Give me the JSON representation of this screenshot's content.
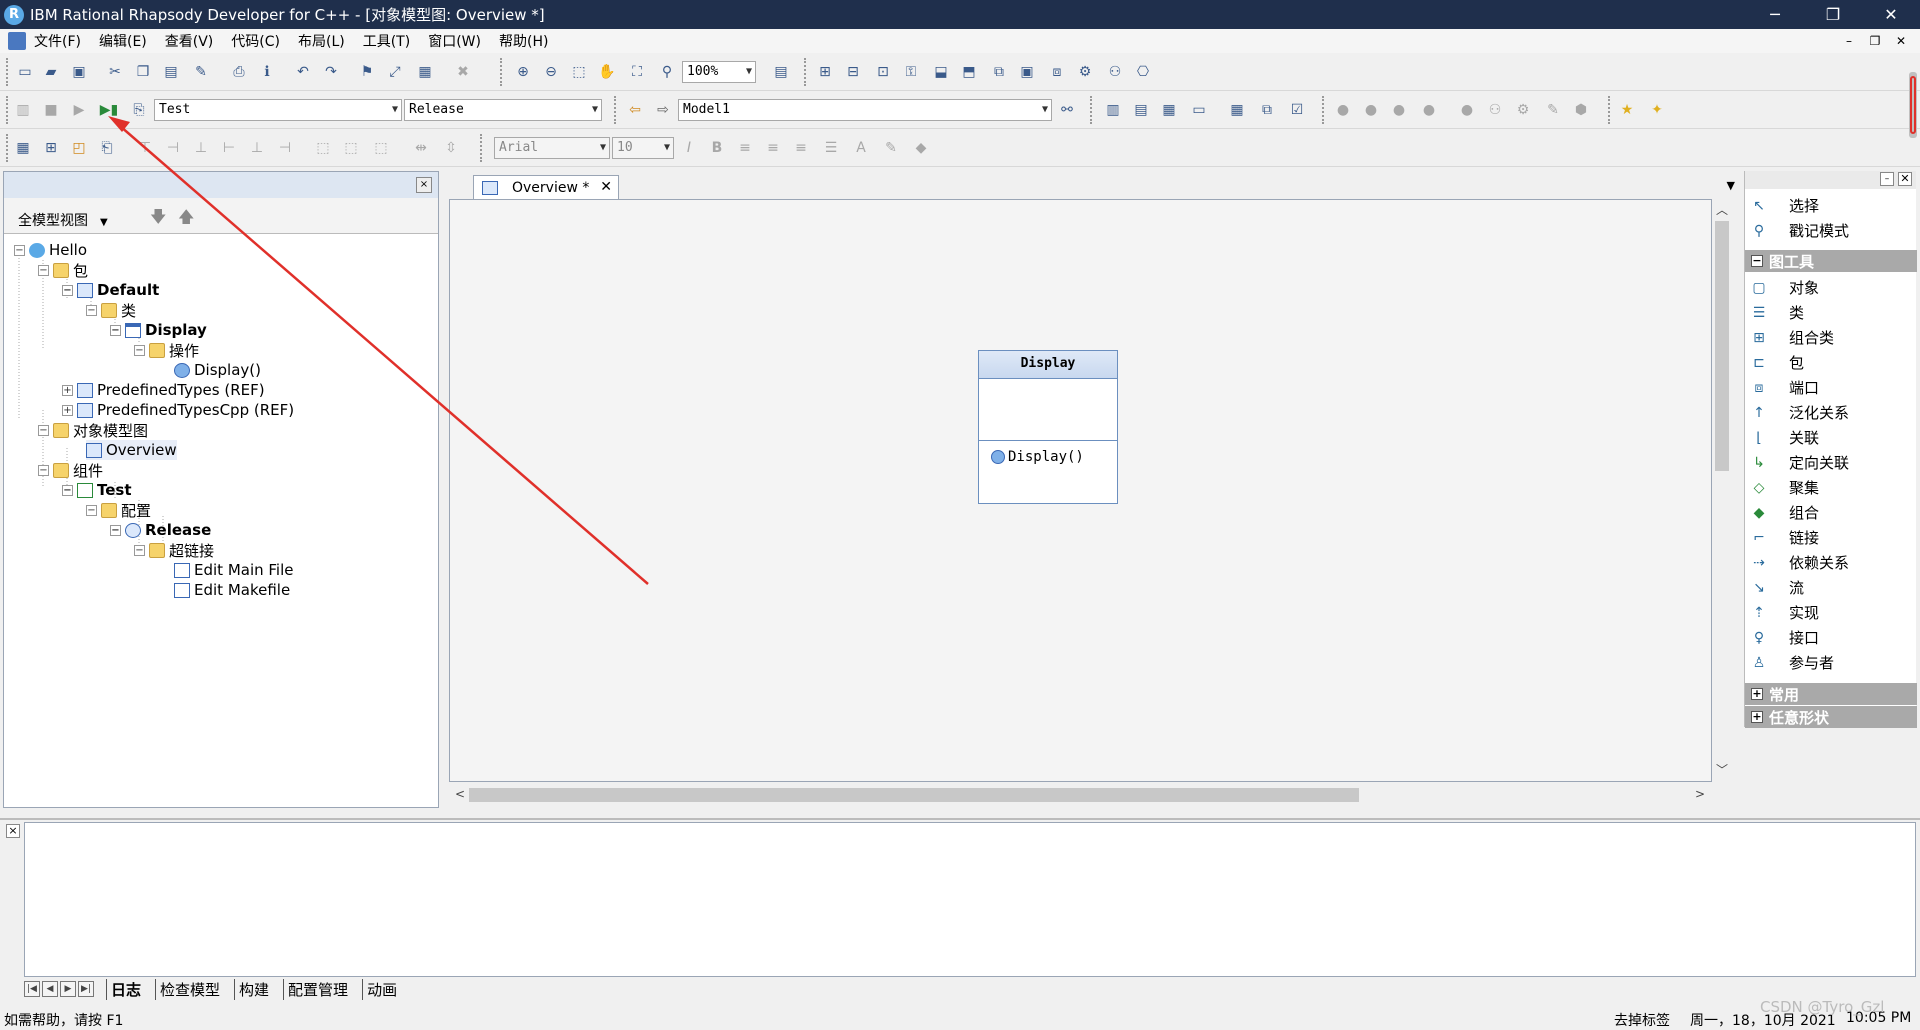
{
  "window": {
    "title": "IBM Rational Rhapsody Developer for C++ - [对象模型图: Overview *]",
    "app_icon": "R",
    "minimize": "─",
    "restore": "❐",
    "close": "✕"
  },
  "menu": {
    "items": [
      "文件(F)",
      "编辑(E)",
      "查看(V)",
      "代码(C)",
      "布局(L)",
      "工具(T)",
      "窗口(W)",
      "帮助(H)"
    ],
    "mdi_min": "–",
    "mdi_restore": "❐",
    "mdi_close": "✕"
  },
  "toolbar": {
    "zoom_value": "100%",
    "component_value": "Test",
    "config_value": "Release",
    "model_value": "Model1",
    "font_value": "Arial",
    "font_size_value": "10",
    "combo_arrow": "▼"
  },
  "left_panel": {
    "close_label": "×",
    "view_selector": "全模型视图",
    "view_arrow": "▼",
    "down_arrow": "🡇",
    "up_arrow": "🡅",
    "tree": [
      {
        "label": "Hello",
        "toggle": "−"
      },
      {
        "label": "包",
        "toggle": "−"
      },
      {
        "label": "Default",
        "toggle": "−"
      },
      {
        "label": "类",
        "toggle": "−"
      },
      {
        "label": "Display",
        "toggle": "−"
      },
      {
        "label": "操作",
        "toggle": "−"
      },
      {
        "label": "Display()",
        "toggle": ""
      },
      {
        "label": "PredefinedTypes (REF)",
        "toggle": "+"
      },
      {
        "label": "PredefinedTypesCpp (REF)",
        "toggle": "+"
      },
      {
        "label": "对象模型图",
        "toggle": "−"
      },
      {
        "label": "Overview",
        "toggle": ""
      },
      {
        "label": "组件",
        "toggle": "−"
      },
      {
        "label": "Test",
        "toggle": "−"
      },
      {
        "label": "配置",
        "toggle": "−"
      },
      {
        "label": "Release",
        "toggle": "−"
      },
      {
        "label": "超链接",
        "toggle": "−"
      },
      {
        "label": "Edit Main File",
        "toggle": ""
      },
      {
        "label": "Edit Makefile",
        "toggle": ""
      }
    ]
  },
  "editor": {
    "tab_label": "Overview *",
    "tab_close": "✕",
    "tabstrip_menu": "▼",
    "class_box": {
      "name": "Display",
      "operation": "Display()"
    },
    "scroll_up": "︿",
    "scroll_down": "﹀",
    "scroll_left": "<",
    "scroll_right": ">"
  },
  "right_panel": {
    "pin_label": "–",
    "close_label": "✕",
    "top_items": [
      {
        "label": "选择",
        "icon": "↖"
      },
      {
        "label": "戳记模式",
        "icon": "⚲"
      }
    ],
    "section_diagram_tools": {
      "label": "图工具",
      "toggle": "−"
    },
    "tools": [
      {
        "label": "对象",
        "icon": "▢"
      },
      {
        "label": "类",
        "icon": "☰"
      },
      {
        "label": "组合类",
        "icon": "⊞"
      },
      {
        "label": "包",
        "icon": "⊏"
      },
      {
        "label": "端口",
        "icon": "⧈"
      },
      {
        "label": "泛化关系",
        "icon": "↑"
      },
      {
        "label": "关联",
        "icon": "⌊"
      },
      {
        "label": "定向关联",
        "icon": "↳"
      },
      {
        "label": "聚集",
        "icon": "◇"
      },
      {
        "label": "组合",
        "icon": "◆"
      },
      {
        "label": "链接",
        "icon": "⌐"
      },
      {
        "label": "依赖关系",
        "icon": "⇢"
      },
      {
        "label": "流",
        "icon": "↘"
      },
      {
        "label": "实现",
        "icon": "⇡"
      },
      {
        "label": "接口",
        "icon": "♀"
      },
      {
        "label": "参与者",
        "icon": "♙"
      }
    ],
    "section_common": {
      "label": "常用",
      "toggle": "+"
    },
    "section_freeshape": {
      "label": "任意形状",
      "toggle": "+"
    }
  },
  "output": {
    "close_label": "×",
    "nav_first": "|◀",
    "nav_prev": "◀",
    "nav_next": "▶",
    "nav_last": "▶|",
    "tabs": [
      "日志",
      "检查模型",
      "构建",
      "配置管理",
      "动画"
    ]
  },
  "status": {
    "help": "如需帮助，请按 F1",
    "locale": "去掉标签",
    "date": "周一，18，10月 2021",
    "time": "10:05  PM"
  },
  "watermark": "CSDN @Tyro_Gzl",
  "colors": {
    "titlebar": "#1f2f4c",
    "annotation_arrow": "#e0302a",
    "class_header": "#c8d8ef"
  }
}
